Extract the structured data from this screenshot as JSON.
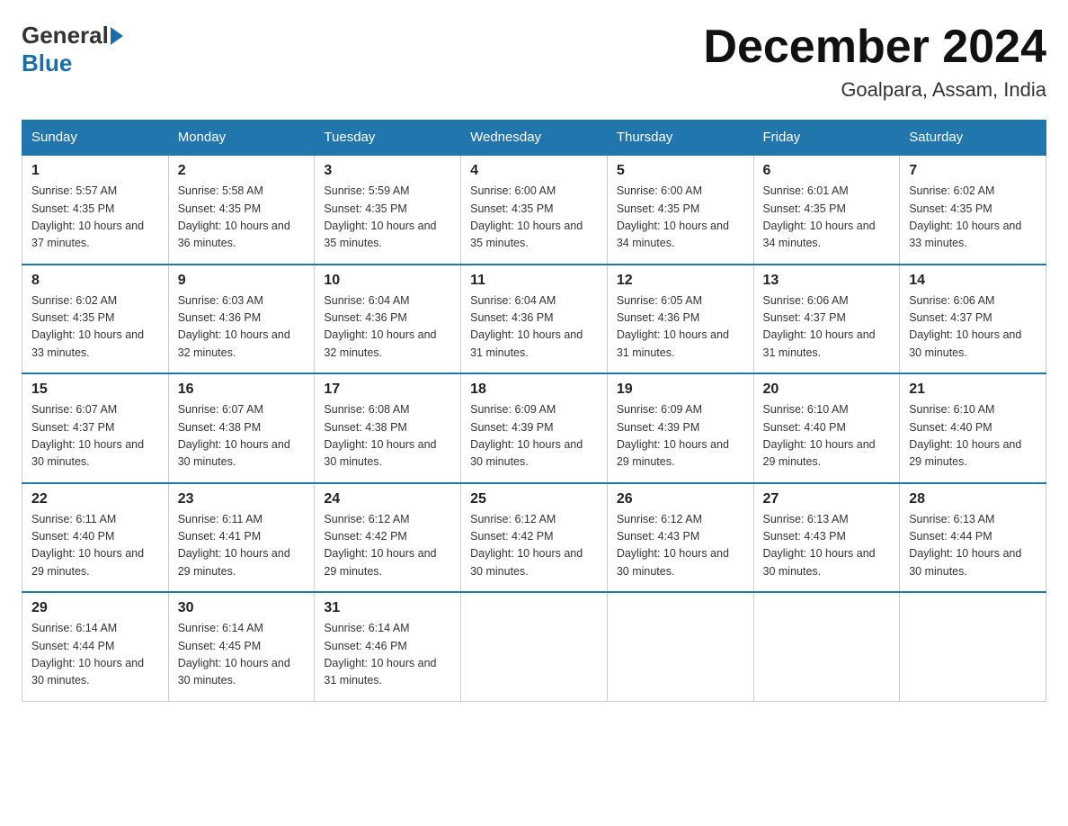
{
  "header": {
    "logo_general": "General",
    "logo_blue": "Blue",
    "month_title": "December 2024",
    "location": "Goalpara, Assam, India"
  },
  "days_of_week": [
    "Sunday",
    "Monday",
    "Tuesday",
    "Wednesday",
    "Thursday",
    "Friday",
    "Saturday"
  ],
  "weeks": [
    [
      {
        "day": "1",
        "sunrise": "5:57 AM",
        "sunset": "4:35 PM",
        "daylight": "10 hours and 37 minutes."
      },
      {
        "day": "2",
        "sunrise": "5:58 AM",
        "sunset": "4:35 PM",
        "daylight": "10 hours and 36 minutes."
      },
      {
        "day": "3",
        "sunrise": "5:59 AM",
        "sunset": "4:35 PM",
        "daylight": "10 hours and 35 minutes."
      },
      {
        "day": "4",
        "sunrise": "6:00 AM",
        "sunset": "4:35 PM",
        "daylight": "10 hours and 35 minutes."
      },
      {
        "day": "5",
        "sunrise": "6:00 AM",
        "sunset": "4:35 PM",
        "daylight": "10 hours and 34 minutes."
      },
      {
        "day": "6",
        "sunrise": "6:01 AM",
        "sunset": "4:35 PM",
        "daylight": "10 hours and 34 minutes."
      },
      {
        "day": "7",
        "sunrise": "6:02 AM",
        "sunset": "4:35 PM",
        "daylight": "10 hours and 33 minutes."
      }
    ],
    [
      {
        "day": "8",
        "sunrise": "6:02 AM",
        "sunset": "4:35 PM",
        "daylight": "10 hours and 33 minutes."
      },
      {
        "day": "9",
        "sunrise": "6:03 AM",
        "sunset": "4:36 PM",
        "daylight": "10 hours and 32 minutes."
      },
      {
        "day": "10",
        "sunrise": "6:04 AM",
        "sunset": "4:36 PM",
        "daylight": "10 hours and 32 minutes."
      },
      {
        "day": "11",
        "sunrise": "6:04 AM",
        "sunset": "4:36 PM",
        "daylight": "10 hours and 31 minutes."
      },
      {
        "day": "12",
        "sunrise": "6:05 AM",
        "sunset": "4:36 PM",
        "daylight": "10 hours and 31 minutes."
      },
      {
        "day": "13",
        "sunrise": "6:06 AM",
        "sunset": "4:37 PM",
        "daylight": "10 hours and 31 minutes."
      },
      {
        "day": "14",
        "sunrise": "6:06 AM",
        "sunset": "4:37 PM",
        "daylight": "10 hours and 30 minutes."
      }
    ],
    [
      {
        "day": "15",
        "sunrise": "6:07 AM",
        "sunset": "4:37 PM",
        "daylight": "10 hours and 30 minutes."
      },
      {
        "day": "16",
        "sunrise": "6:07 AM",
        "sunset": "4:38 PM",
        "daylight": "10 hours and 30 minutes."
      },
      {
        "day": "17",
        "sunrise": "6:08 AM",
        "sunset": "4:38 PM",
        "daylight": "10 hours and 30 minutes."
      },
      {
        "day": "18",
        "sunrise": "6:09 AM",
        "sunset": "4:39 PM",
        "daylight": "10 hours and 30 minutes."
      },
      {
        "day": "19",
        "sunrise": "6:09 AM",
        "sunset": "4:39 PM",
        "daylight": "10 hours and 29 minutes."
      },
      {
        "day": "20",
        "sunrise": "6:10 AM",
        "sunset": "4:40 PM",
        "daylight": "10 hours and 29 minutes."
      },
      {
        "day": "21",
        "sunrise": "6:10 AM",
        "sunset": "4:40 PM",
        "daylight": "10 hours and 29 minutes."
      }
    ],
    [
      {
        "day": "22",
        "sunrise": "6:11 AM",
        "sunset": "4:40 PM",
        "daylight": "10 hours and 29 minutes."
      },
      {
        "day": "23",
        "sunrise": "6:11 AM",
        "sunset": "4:41 PM",
        "daylight": "10 hours and 29 minutes."
      },
      {
        "day": "24",
        "sunrise": "6:12 AM",
        "sunset": "4:42 PM",
        "daylight": "10 hours and 29 minutes."
      },
      {
        "day": "25",
        "sunrise": "6:12 AM",
        "sunset": "4:42 PM",
        "daylight": "10 hours and 30 minutes."
      },
      {
        "day": "26",
        "sunrise": "6:12 AM",
        "sunset": "4:43 PM",
        "daylight": "10 hours and 30 minutes."
      },
      {
        "day": "27",
        "sunrise": "6:13 AM",
        "sunset": "4:43 PM",
        "daylight": "10 hours and 30 minutes."
      },
      {
        "day": "28",
        "sunrise": "6:13 AM",
        "sunset": "4:44 PM",
        "daylight": "10 hours and 30 minutes."
      }
    ],
    [
      {
        "day": "29",
        "sunrise": "6:14 AM",
        "sunset": "4:44 PM",
        "daylight": "10 hours and 30 minutes."
      },
      {
        "day": "30",
        "sunrise": "6:14 AM",
        "sunset": "4:45 PM",
        "daylight": "10 hours and 30 minutes."
      },
      {
        "day": "31",
        "sunrise": "6:14 AM",
        "sunset": "4:46 PM",
        "daylight": "10 hours and 31 minutes."
      },
      null,
      null,
      null,
      null
    ]
  ]
}
